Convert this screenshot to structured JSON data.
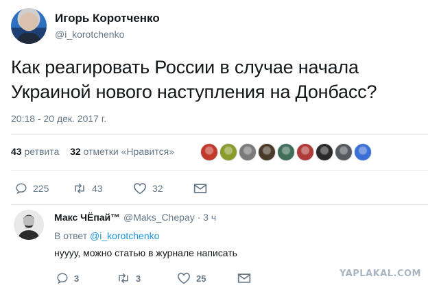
{
  "tweet": {
    "author_name": "Игорь Коротченко",
    "author_handle": "@i_korotchenko",
    "text": "Как реагировать России в случае начала Украиной нового наступления на Донбасс?",
    "timestamp": "20:18 - 20 дек. 2017 г."
  },
  "stats": {
    "retweets_count": "43",
    "retweets_label": "ретвита",
    "likes_count": "32",
    "likes_label": "отметки «Нравится»"
  },
  "likers": [
    {
      "name": "liker-avatar-1",
      "color": "#c0392b"
    },
    {
      "name": "liker-avatar-2",
      "color": "#8a9a2b"
    },
    {
      "name": "liker-avatar-3",
      "color": "#7a7a7a"
    },
    {
      "name": "liker-avatar-4",
      "color": "#4a3a2a"
    },
    {
      "name": "liker-avatar-5",
      "color": "#3f6d5a"
    },
    {
      "name": "liker-avatar-6",
      "color": "#b03a3a"
    },
    {
      "name": "liker-avatar-7",
      "color": "#2a2a2a"
    },
    {
      "name": "liker-avatar-8",
      "color": "#555a60"
    },
    {
      "name": "liker-avatar-9",
      "color": "#3b6fd6"
    }
  ],
  "actions": {
    "replies": "225",
    "retweets": "43",
    "likes": "32"
  },
  "reply": {
    "author_name": "Макс ЧЁпай™",
    "author_handle": "@Maks_Chepay",
    "dot": "·",
    "time": "3 ч",
    "reply_to_prefix": "В ответ",
    "reply_to_handle": "@i_korotchenko",
    "text": "нуууу, можно статью в журнале написать",
    "replies": "3",
    "retweets": "3",
    "likes": "25"
  },
  "watermark": "YAPLAKAL.COM",
  "colors": {
    "link": "#1b95e0",
    "muted": "#657786",
    "text": "#14171a"
  }
}
